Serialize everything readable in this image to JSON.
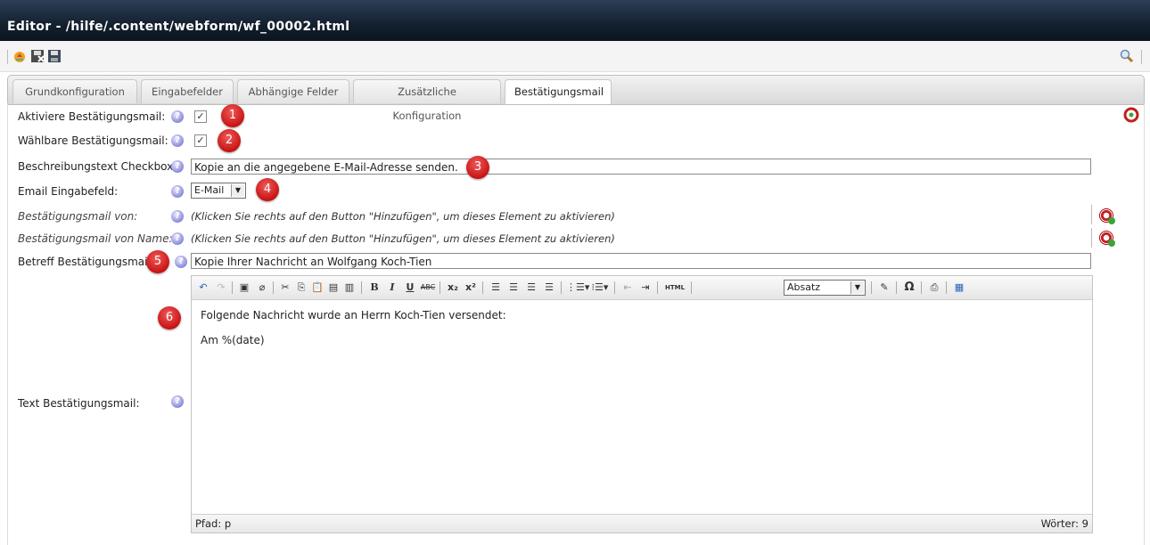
{
  "window": {
    "title": "Editor - /hilfe/.content/webform/wf_00002.html"
  },
  "tabs": [
    {
      "label": "Grundkonfiguration",
      "active": false
    },
    {
      "label": "Eingabefelder",
      "active": false
    },
    {
      "label": "Abhängige Felder",
      "active": false
    },
    {
      "label": "Zusätzliche Konfiguration",
      "active": false
    },
    {
      "label": "Bestätigungsmail",
      "active": true
    }
  ],
  "form": {
    "activate_label": "Aktiviere Bestätigungsmail:",
    "activate_checked": true,
    "selectable_label": "Wählbare Bestätigungsmail:",
    "selectable_checked": true,
    "checkbox_text_label": "Beschreibungstext Checkbox:",
    "checkbox_text_value": "Kopie an die angegebene E-Mail-Adresse senden.",
    "email_field_label": "Email Eingabefeld:",
    "email_field_value": "E-Mail",
    "from_label": "Bestätigungsmail von:",
    "from_hint": "(Klicken Sie rechts auf den Button \"Hinzufügen\", um dieses Element zu aktivieren)",
    "from_name_label": "Bestätigungsmail von Name:",
    "from_name_hint": "(Klicken Sie rechts auf den Button \"Hinzufügen\", um dieses Element zu aktivieren)",
    "subject_label": "Betreff Bestätigungsmail:",
    "subject_value": "Kopie Ihrer Nachricht an Wolfgang Koch-Tien",
    "text_label": "Text Bestätigungsmail:"
  },
  "editor": {
    "format_value": "Absatz",
    "html_button": "HTML",
    "body_line1": "Folgende Nachricht wurde an Herrn Koch-Tien versendet:",
    "body_line2": "Am %(date)",
    "path": "Pfad: p",
    "word_count": "Wörter: 9"
  },
  "badges": [
    "1",
    "2",
    "3",
    "4",
    "5",
    "6"
  ],
  "icons": {
    "help": "?",
    "check": "✓",
    "dropdown": "▼"
  },
  "colors": {
    "title_bg": "#13202f",
    "badge": "#c81414",
    "help": "#8a8ad8"
  }
}
